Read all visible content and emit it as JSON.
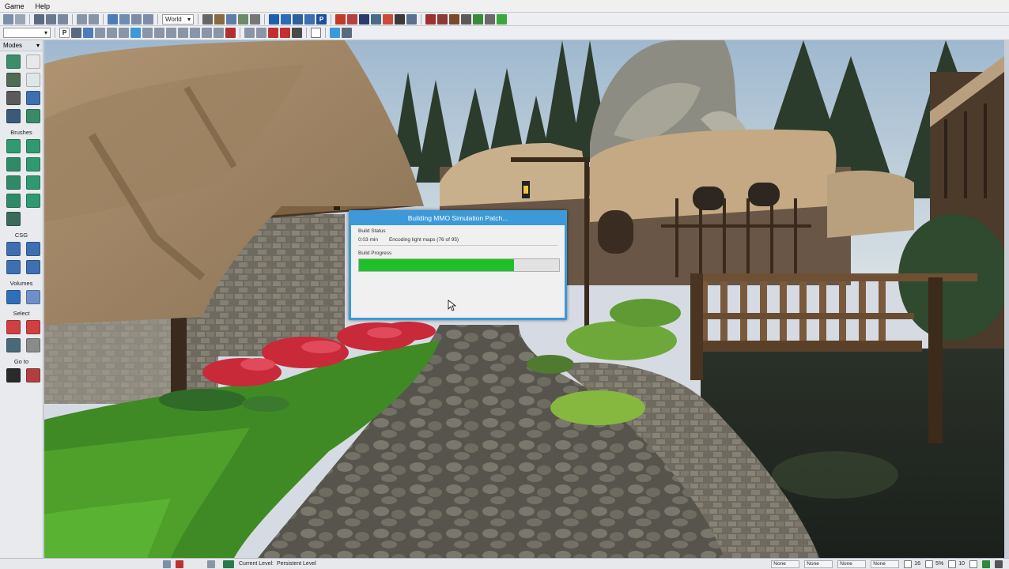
{
  "menu": {
    "items": [
      "Game",
      "Help"
    ]
  },
  "toolbar": {
    "world_combo": "World"
  },
  "left_panel": {
    "modes_label": "Modes",
    "sections": {
      "brushes": "Brushes",
      "csg": "CSG",
      "volumes": "Volumes",
      "select": "Select",
      "go_to": "Go to"
    }
  },
  "dialog": {
    "title": "Building MMO Simulation Patch...",
    "build_status_label": "Build Status",
    "elapsed": "0:03 min",
    "status_text": "Encoding light maps (76 of 95)",
    "build_progress_label": "Build Progress",
    "progress_fraction": 0.775
  },
  "statusbar": {
    "current_level_label": "Current Level:",
    "current_level_value": "Persistent Level",
    "field1": "None",
    "field2": "None",
    "field3": "None",
    "field4": "None",
    "grid": "16",
    "percent": "5%",
    "rot": "10"
  },
  "colors": {
    "accent": "#3d99d8",
    "progress": "#1ec02a"
  }
}
